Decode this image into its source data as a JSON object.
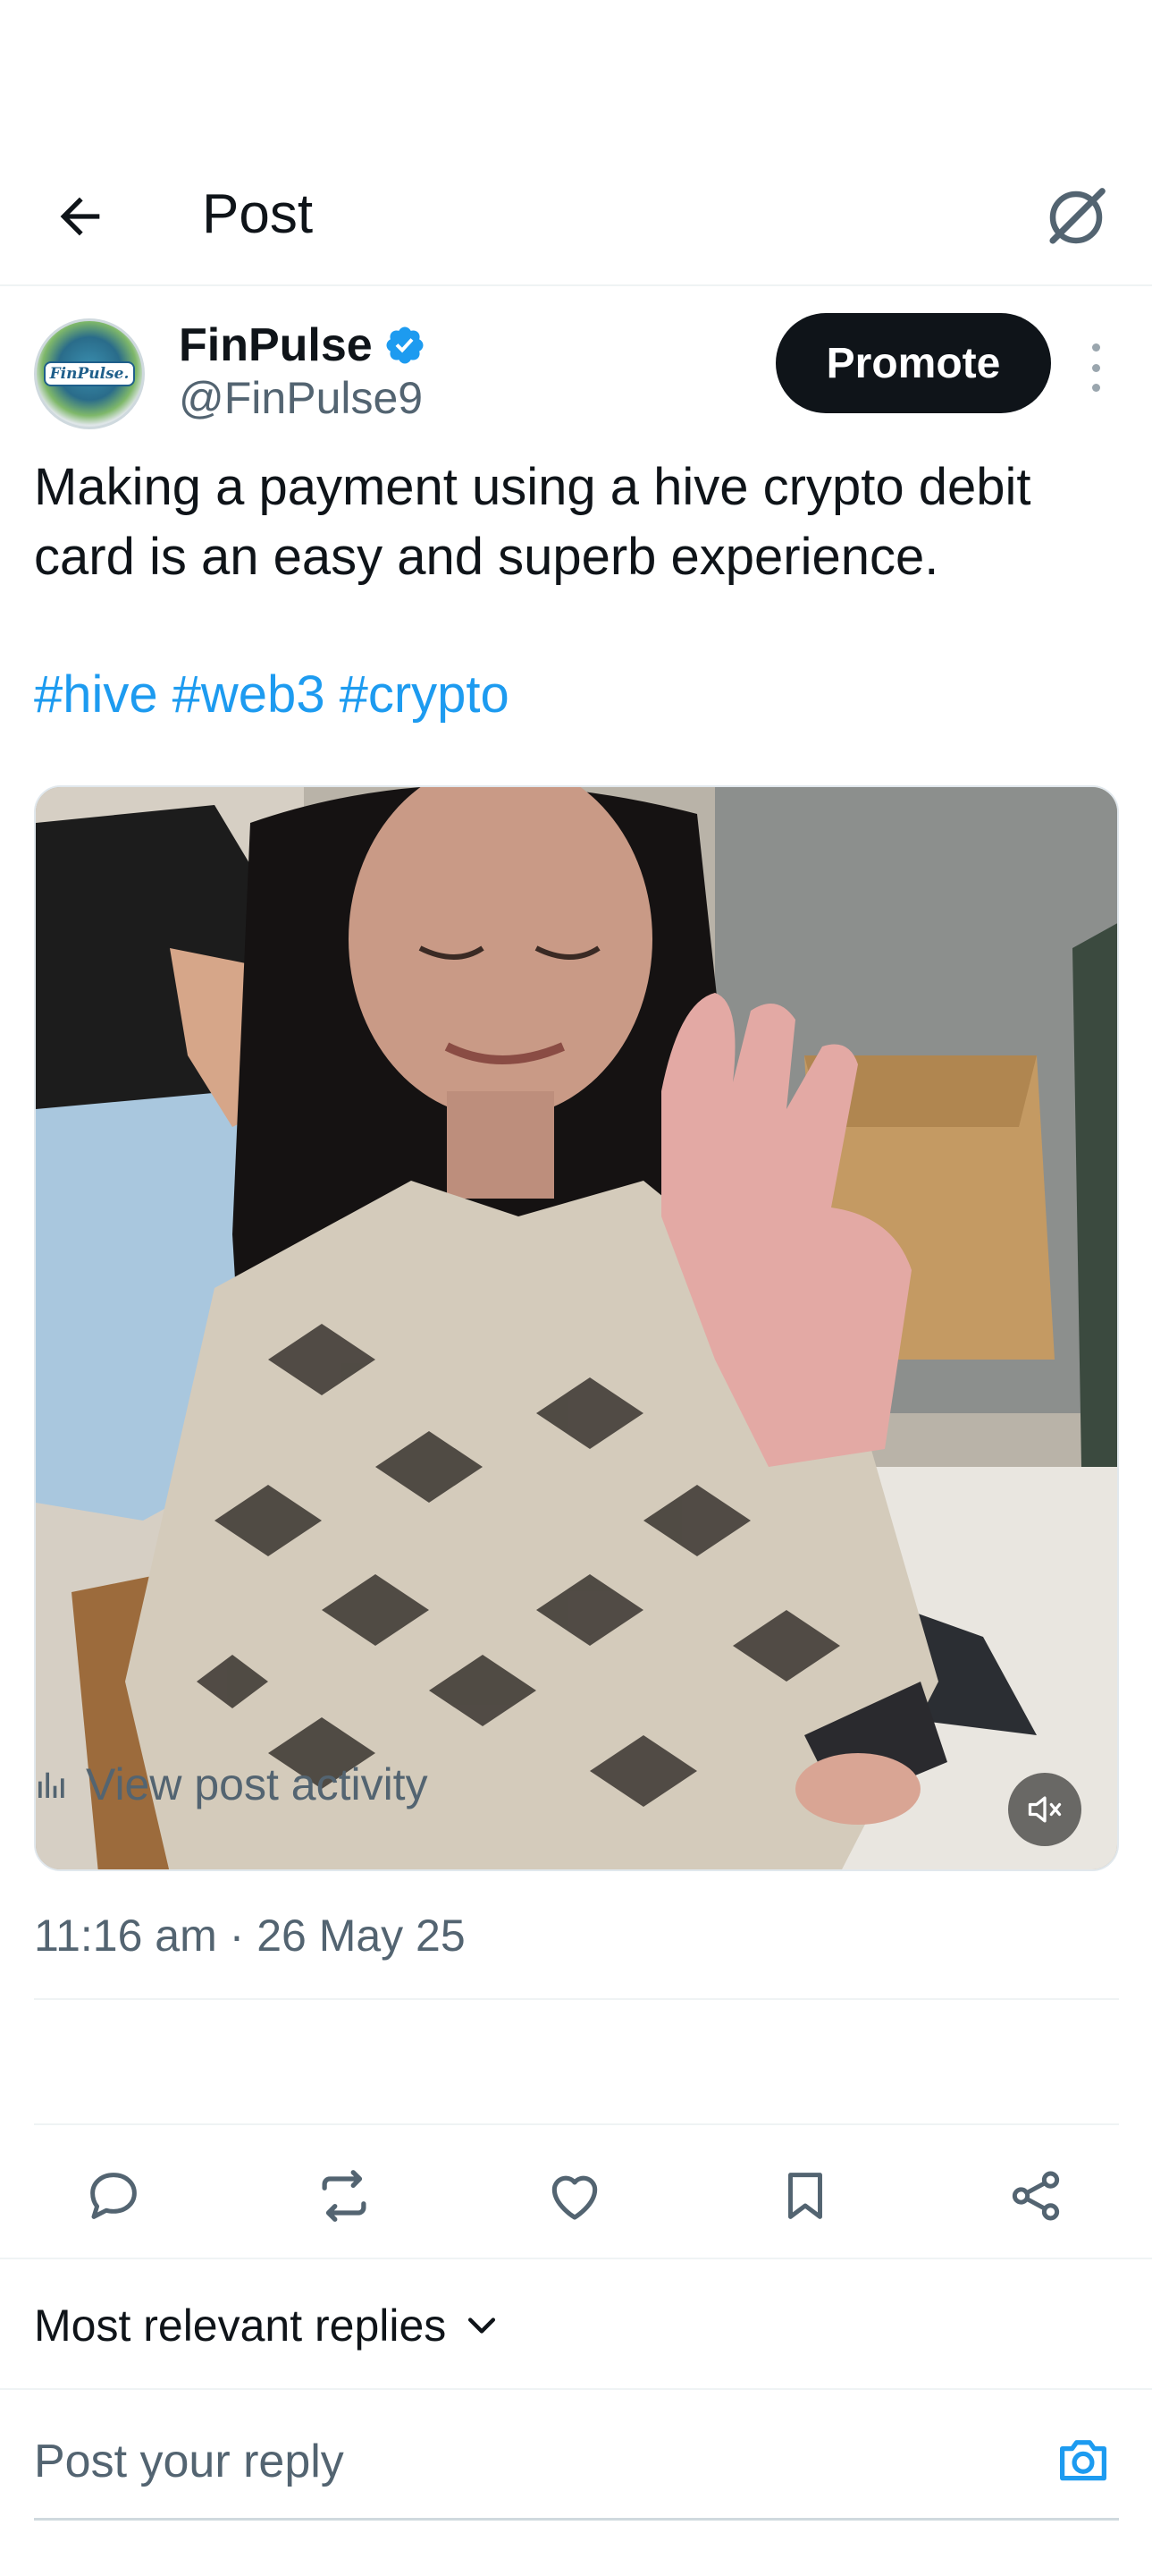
{
  "header": {
    "title": "Post",
    "back_icon": "arrow-left-icon",
    "grok_icon": "grok-icon"
  },
  "post": {
    "author": {
      "name": "FinPulse",
      "handle": "@FinPulse9",
      "avatar_text": "FinPulse.",
      "verified": true,
      "verified_color": "#1d9bf0"
    },
    "promote_label": "Promote",
    "text": "Making a payment using a hive crypto debit card is an easy and superb experience.",
    "hashtags": [
      "#hive",
      "#web3",
      "#crypto"
    ],
    "media": {
      "type": "video",
      "muted": true
    },
    "timestamp": "11:16 am · 26 May 25",
    "activity_label": "View post activity"
  },
  "actions": [
    "reply-icon",
    "repost-icon",
    "like-icon",
    "bookmark-icon",
    "share-icon"
  ],
  "replies": {
    "sort_label": "Most relevant replies",
    "reply_placeholder": "Post your reply"
  },
  "colors": {
    "accent": "#1d9bf0",
    "text_primary": "#0f1419",
    "text_secondary": "#536471",
    "promote_bg": "#0f1419"
  }
}
